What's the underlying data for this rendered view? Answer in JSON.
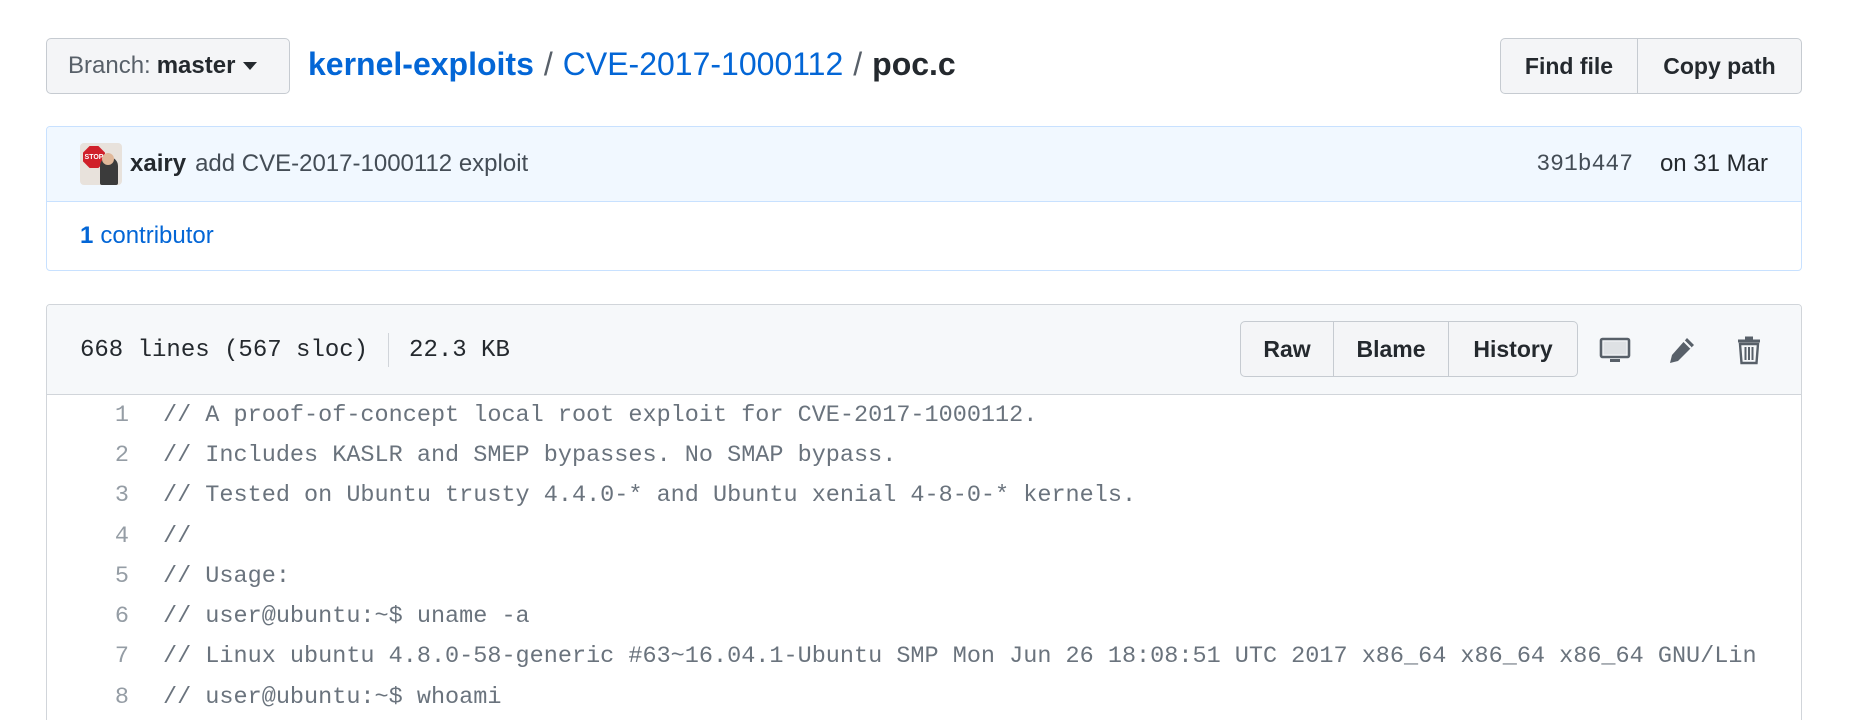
{
  "branch": {
    "prefix": "Branch:",
    "name": "master"
  },
  "breadcrumb": {
    "repo": "kernel-exploits",
    "sep1": "/",
    "dir": "CVE-2017-1000112",
    "sep2": "/",
    "file": "poc.c"
  },
  "actions": {
    "find_file": "Find file",
    "copy_path": "Copy path"
  },
  "commit": {
    "author": "xairy",
    "message": "add CVE-2017-1000112 exploit",
    "sha": "391b447",
    "date": "on 31 Mar",
    "avatar_badge": "STOP"
  },
  "contributors": {
    "count": "1",
    "label": "contributor"
  },
  "file": {
    "lines_info": "668 lines (567 sloc)",
    "size": "22.3 KB",
    "raw_label": "Raw",
    "blame_label": "Blame",
    "history_label": "History"
  },
  "icons": {
    "desktop": "desktop-icon",
    "pencil": "pencil-icon",
    "trash": "trash-icon"
  },
  "colors": {
    "link": "#0366d6",
    "commit_bg": "#f1f8ff",
    "comment": "#6a737d"
  },
  "code_lines": [
    {
      "num": "1",
      "text": "// A proof-of-concept local root exploit for CVE-2017-1000112."
    },
    {
      "num": "2",
      "text": "// Includes KASLR and SMEP bypasses. No SMAP bypass."
    },
    {
      "num": "3",
      "text": "// Tested on Ubuntu trusty 4.4.0-* and Ubuntu xenial 4-8-0-* kernels."
    },
    {
      "num": "4",
      "text": "//"
    },
    {
      "num": "5",
      "text": "// Usage:"
    },
    {
      "num": "6",
      "text": "// user@ubuntu:~$ uname -a"
    },
    {
      "num": "7",
      "text": "// Linux ubuntu 4.8.0-58-generic #63~16.04.1-Ubuntu SMP Mon Jun 26 18:08:51 UTC 2017 x86_64 x86_64 x86_64 GNU/Lin"
    },
    {
      "num": "8",
      "text": "// user@ubuntu:~$ whoami"
    }
  ]
}
